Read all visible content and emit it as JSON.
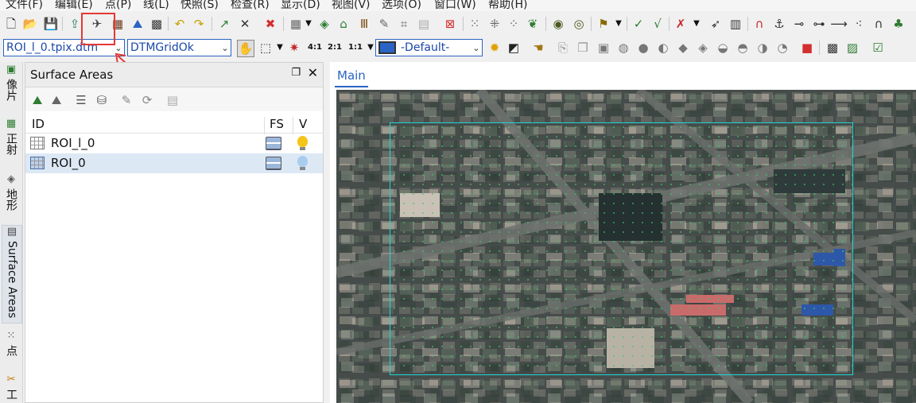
{
  "menu": [
    "文件(F)",
    "编辑(E)",
    "点(P)",
    "线(L)",
    "快照(S)",
    "检查(R)",
    "显示(D)",
    "视图(V)",
    "选项(O)",
    "窗口(W)",
    "帮助(H)"
  ],
  "toolbar2": {
    "combo_file": "ROI_l_0.tpix.dtm",
    "combo_layer": "DTMGridOk",
    "combo_view": "-Default-",
    "zoom_labels": [
      "4:1",
      "2:1",
      "1:1"
    ]
  },
  "side_tabs": [
    "像片",
    "正射",
    "地形",
    "Surface Areas",
    "点",
    "工"
  ],
  "panel": {
    "title": "Surface Areas",
    "columns": {
      "id": "ID",
      "fs": "FS",
      "v": "V"
    },
    "rows": [
      {
        "id": "ROI_l_0",
        "bulb_color": "#f5c518",
        "selected": false
      },
      {
        "id": "ROI_0",
        "bulb_color": "#a9cdee",
        "selected": true
      }
    ]
  },
  "main": {
    "tab": "Main"
  },
  "colors": {
    "accent": "#2a64c4",
    "annotation": "#e53935",
    "roi_border": "#1fd6d6",
    "dtm_points": "#3ec46a"
  },
  "icons": {
    "toolbar1": [
      "new-file-icon",
      "open-folder-icon",
      "save-icon",
      "import-photo-icon",
      "point-measure-icon",
      "grid-icon",
      "grid-check-icon",
      "undo-icon",
      "redo-icon",
      "add-point-icon",
      "cross-tool-icon",
      "delete-x-icon",
      "grid-pattern-icon",
      "layer-icon",
      "snap-icon",
      "ladder-icon",
      "pencil-icon",
      "measure-icon",
      "delete-red-icon",
      "dots-icon",
      "plus-dots-icon",
      "pattern-icon",
      "eye-icon",
      "eye-dropper-icon",
      "pin-icon",
      "v-icon",
      "cross-red-icon",
      "arrow-icon",
      "bar-chart-icon",
      "magnet-icon",
      "anchor-icon",
      "line-node-icon",
      "line-node2-icon",
      "arrow-line-icon",
      "scatter-icon",
      "arch-icon",
      "tree-icon"
    ],
    "toolbar2": [
      "hand-icon",
      "select-icon",
      "crosshair-icon",
      "monitor-icon",
      "sun-icon",
      "contrast-icon",
      "hand-lock-icon",
      "stamp-icon",
      "copy-icon",
      "scene-icon",
      "mesh-icon",
      "sphere-icon",
      "sphere2-icon",
      "cube-icon",
      "cube2-icon",
      "dome-icon",
      "dome2-icon",
      "dome3-icon",
      "red-blue-icon",
      "map-icon",
      "green-map-icon",
      "chart-check-icon"
    ],
    "panel_tools": [
      "add-area-icon",
      "area-icon",
      "stack-icon",
      "db-icon",
      "edit-icon",
      "refresh-icon",
      "pattern-icon"
    ]
  }
}
